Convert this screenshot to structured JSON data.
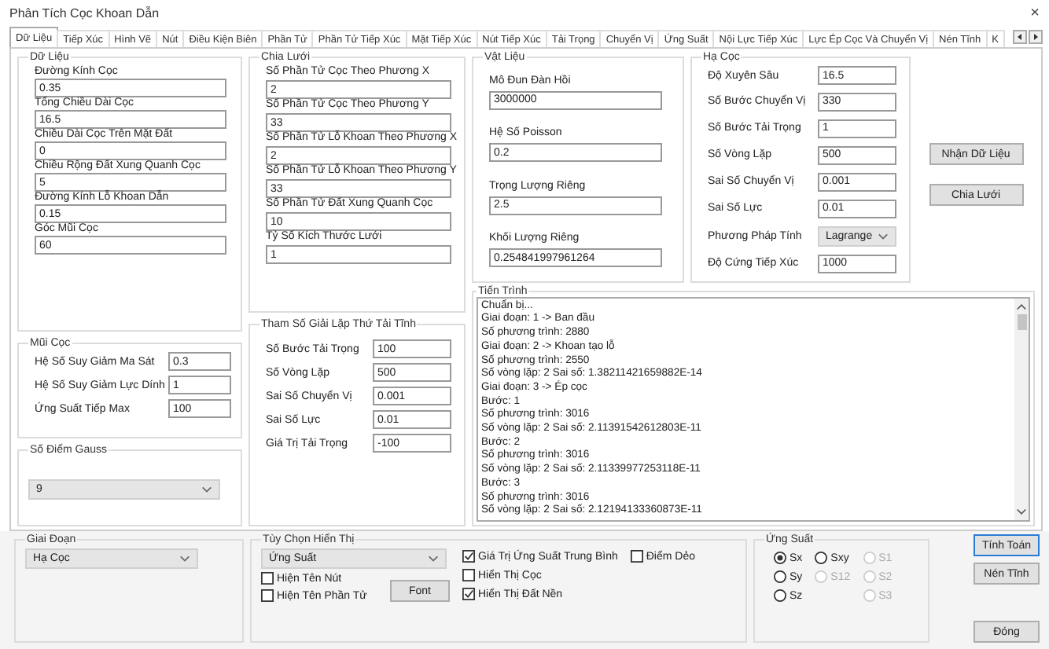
{
  "window": {
    "title": "Phân Tích Cọc Khoan Dẫn",
    "close": "×"
  },
  "tabs": [
    {
      "label": "Dữ Liệu",
      "selected": true
    },
    {
      "label": "Tiếp Xúc",
      "selected": false
    },
    {
      "label": "Hình Vẽ",
      "selected": false
    },
    {
      "label": "Nút",
      "selected": false
    },
    {
      "label": "Điều Kiện Biên",
      "selected": false
    },
    {
      "label": "Phần Tử",
      "selected": false
    },
    {
      "label": "Phần Tử Tiếp Xúc",
      "selected": false
    },
    {
      "label": "Mặt Tiếp Xúc",
      "selected": false
    },
    {
      "label": "Nút Tiếp Xúc",
      "selected": false
    },
    {
      "label": "Tải Trọng",
      "selected": false
    },
    {
      "label": "Chuyển Vị",
      "selected": false
    },
    {
      "label": "Ứng Suất",
      "selected": false
    },
    {
      "label": "Nội Lực Tiếp Xúc",
      "selected": false
    },
    {
      "label": "Lực Ép Cọc Và Chuyển Vị",
      "selected": false
    },
    {
      "label": "Nén Tĩnh",
      "selected": false
    },
    {
      "label": "K",
      "selected": false
    }
  ],
  "du_lieu": {
    "title": "Dữ Liệu",
    "fields": [
      {
        "label": "Đường Kính Cọc",
        "value": "0.35"
      },
      {
        "label": "Tổng Chiều Dài Cọc",
        "value": "16.5"
      },
      {
        "label": "Chiều Dài Cọc Trên Mặt Đất",
        "value": "0"
      },
      {
        "label": "Chiều Rộng Đất Xung Quanh Cọc",
        "value": "5"
      },
      {
        "label": "Đường Kính Lỗ Khoan Dẫn",
        "value": "0.15"
      },
      {
        "label": "Góc Mũi Cọc",
        "value": "60"
      }
    ]
  },
  "mui_coc": {
    "title": "Mũi Cọc",
    "fields": [
      {
        "label": "Hệ Số Suy Giảm Ma Sát",
        "value": "0.3"
      },
      {
        "label": "Hệ Số Suy Giảm Lực Dính",
        "value": "1"
      },
      {
        "label": "Ứng Suất Tiếp Max",
        "value": "100"
      }
    ]
  },
  "so_diem_gauss": {
    "title": "Số Điểm Gauss",
    "value": "9"
  },
  "chia_luoi": {
    "title": "Chia Lưới",
    "fields": [
      {
        "label": "Số Phần Tử Cọc Theo Phương X",
        "value": "2"
      },
      {
        "label": "Số Phần Tử Cọc Theo Phương Y",
        "value": "33"
      },
      {
        "label": "Số Phần Tử Lỗ Khoan Theo Phương X",
        "value": "2"
      },
      {
        "label": "Số Phần Tử Lỗ Khoan Theo Phương Y",
        "value": "33"
      },
      {
        "label": "Số Phần Tử Đất Xung Quanh Cọc",
        "value": "10"
      },
      {
        "label": "Tỷ Số Kích Thước Lưới",
        "value": "1"
      }
    ]
  },
  "tham_so": {
    "title": "Tham Số Giải Lặp Thứ Tải Tĩnh",
    "fields": [
      {
        "label": "Số Bước Tải Trọng",
        "value": "100"
      },
      {
        "label": "Số Vòng Lặp",
        "value": "500"
      },
      {
        "label": "Sai Số Chuyển Vị",
        "value": "0.001"
      },
      {
        "label": "Sai Số Lực",
        "value": "0.01"
      },
      {
        "label": "Giá Trị Tải Trọng",
        "value": "-100"
      }
    ]
  },
  "vat_lieu": {
    "title": "Vật Liệu",
    "fields": [
      {
        "label": "Mô Đun Đàn Hồi",
        "value": "3000000"
      },
      {
        "label": "Hệ Số Poisson",
        "value": "0.2"
      },
      {
        "label": "Trọng Lượng Riêng",
        "value": "2.5"
      },
      {
        "label": "Khối Lượng Riêng",
        "value": "0.254841997961264"
      }
    ]
  },
  "ha_coc": {
    "title": "Hạ Cọc",
    "fields": [
      {
        "label": "Độ Xuyên Sâu",
        "value": "16.5",
        "kind": "text"
      },
      {
        "label": "Số Bước Chuyển Vị",
        "value": "330",
        "kind": "text"
      },
      {
        "label": "Số Bước Tải Trọng",
        "value": "1",
        "kind": "text"
      },
      {
        "label": "Số Vòng Lặp",
        "value": "500",
        "kind": "text"
      },
      {
        "label": "Sai Số Chuyển Vị",
        "value": "0.001",
        "kind": "text"
      },
      {
        "label": "Sai Số Lực",
        "value": "0.01",
        "kind": "text"
      },
      {
        "label": "Phương Pháp Tính",
        "value": "Lagrange",
        "kind": "dropdown"
      },
      {
        "label": "Độ Cứng Tiếp Xúc",
        "value": "1000",
        "kind": "text"
      }
    ]
  },
  "actions": [
    "Nhận Dữ Liệu",
    "Chia Lưới"
  ],
  "tien_trinh": {
    "title": "Tiến Trình",
    "lines": [
      "Chuẩn bị...",
      "Giai đoạn: 1 -> Ban đầu",
      "Số phương trình: 2880",
      "Giai đoạn: 2 -> Khoan tạo lỗ",
      "Số phương trình: 2550",
      "Số vòng lặp: 2 Sai số: 1.38211421659882E-14",
      "Giai đoạn: 3 -> Ép cọc",
      "Bước: 1",
      "Số phương trình: 3016",
      "Số vòng lặp: 2 Sai số: 2.11391542612803E-11",
      "Bước: 2",
      "Số phương trình: 3016",
      "Số vòng lặp: 2 Sai số: 2.11339977253118E-11",
      "Bước: 3",
      "Số phương trình: 3016",
      "Số vòng lặp: 2 Sai số: 2.12194133360873E-11"
    ]
  },
  "giai_doan": {
    "title": "Giai Đoạn",
    "value": "Hạ Cọc"
  },
  "tuy_chon": {
    "title": "Tùy Chọn Hiển Thị",
    "value": "Ứng Suất",
    "font_button": "Font",
    "left_checks": [
      {
        "label": "Hiện Tên Nút",
        "checked": false
      },
      {
        "label": "Hiện Tên Phần Tử",
        "checked": false
      }
    ],
    "right_checks": [
      {
        "label": "Giá Trị Ứng Suất Trung Bình",
        "checked": true
      },
      {
        "label": "Điểm Dẻo",
        "checked": false
      },
      {
        "label": "Hiển Thị Cọc",
        "checked": false
      },
      {
        "label": "Hiển Thị Đất Nền",
        "checked": true
      }
    ]
  },
  "ung_suat": {
    "title": "Ứng Suất",
    "columns": [
      [
        {
          "label": "Sx",
          "selected": true,
          "disabled": false
        },
        {
          "label": "Sy",
          "selected": false,
          "disabled": false
        },
        {
          "label": "Sz",
          "selected": false,
          "disabled": false
        }
      ],
      [
        {
          "label": "Sxy",
          "selected": false,
          "disabled": false
        },
        {
          "label": "S12",
          "selected": false,
          "disabled": true
        }
      ],
      [
        {
          "label": "S1",
          "selected": false,
          "disabled": true
        },
        {
          "label": "S2",
          "selected": false,
          "disabled": true
        },
        {
          "label": "S3",
          "selected": false,
          "disabled": true
        }
      ]
    ]
  },
  "buttons": [
    {
      "label": "Tính Toán",
      "focused": true
    },
    {
      "label": "Nén Tĩnh",
      "focused": false
    },
    {
      "label": "Đóng",
      "focused": false
    }
  ]
}
